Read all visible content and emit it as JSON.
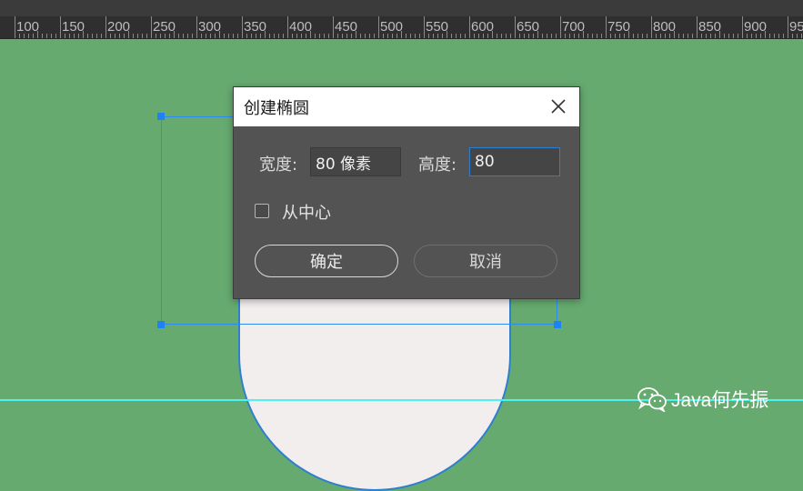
{
  "ruler": {
    "labels": [
      "100",
      "150",
      "200",
      "250",
      "300",
      "350",
      "400",
      "450",
      "500",
      "550",
      "600",
      "650",
      "700",
      "750",
      "800",
      "850",
      "900",
      "95"
    ]
  },
  "dialog": {
    "title": "创建椭圆",
    "width_label": "宽度:",
    "width_value": "80 像素",
    "height_label": "高度:",
    "height_value": "80",
    "from_center_label": "从中心",
    "from_center_checked": false,
    "ok_label": "确定",
    "cancel_label": "取消"
  },
  "icons": {
    "close": "close-icon",
    "watermark": "wechat-icon"
  },
  "watermark": {
    "text": "Java何先振"
  },
  "colors": {
    "canvas": "#66aa6f",
    "shape_fill": "#f3eeee",
    "selection": "#2d8cf0",
    "guide": "#4cf2f2",
    "dialog_bg": "#535353"
  }
}
